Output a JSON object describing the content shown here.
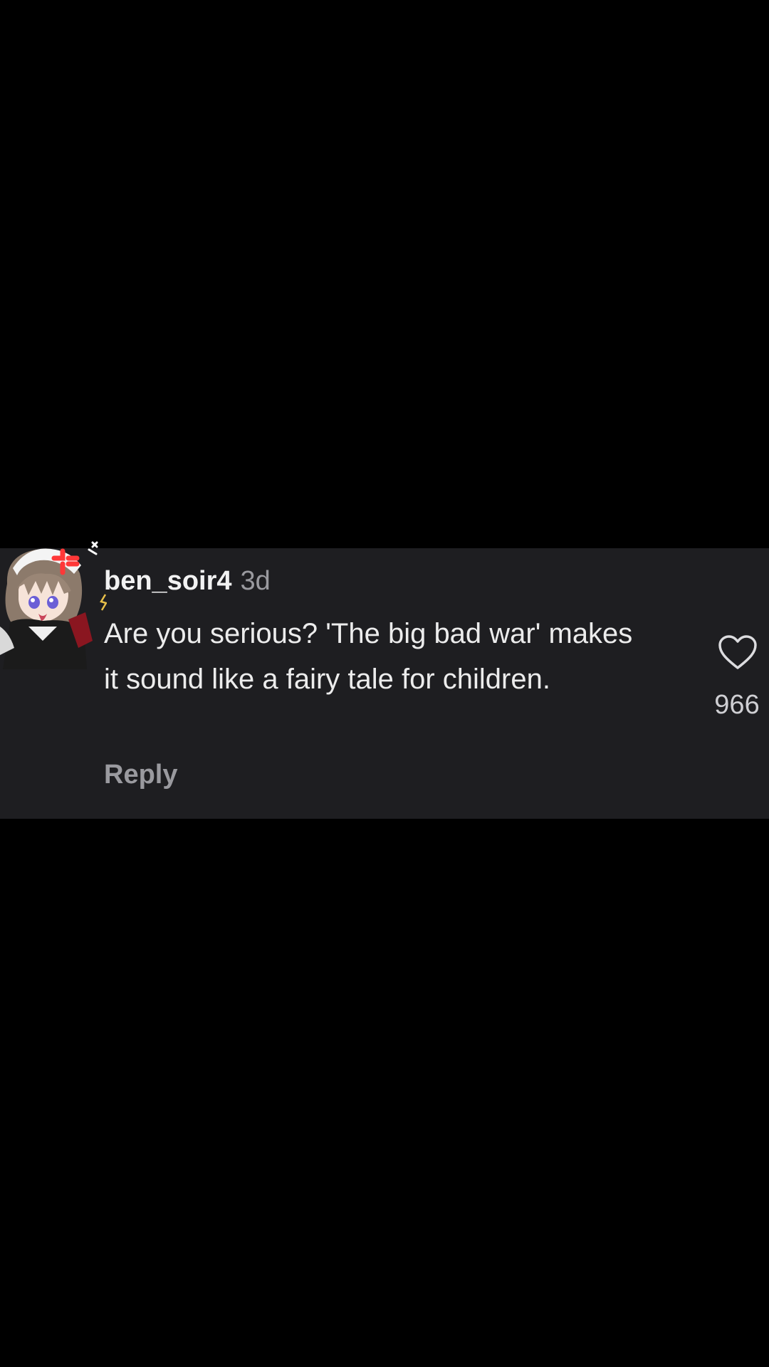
{
  "comment": {
    "username": "ben_soir4",
    "timestamp": "3d",
    "text": "Are you serious? 'The big bad war' makes it sound like a fairy tale for children.",
    "reply_label": "Reply",
    "like_count": "966",
    "avatar_icon": "anime-character-avatar",
    "like_icon": "heart-outline-icon"
  },
  "colors": {
    "background": "#000000",
    "card_background": "#1e1e21",
    "primary_text": "#ececec",
    "secondary_text": "#9a9a9f"
  }
}
